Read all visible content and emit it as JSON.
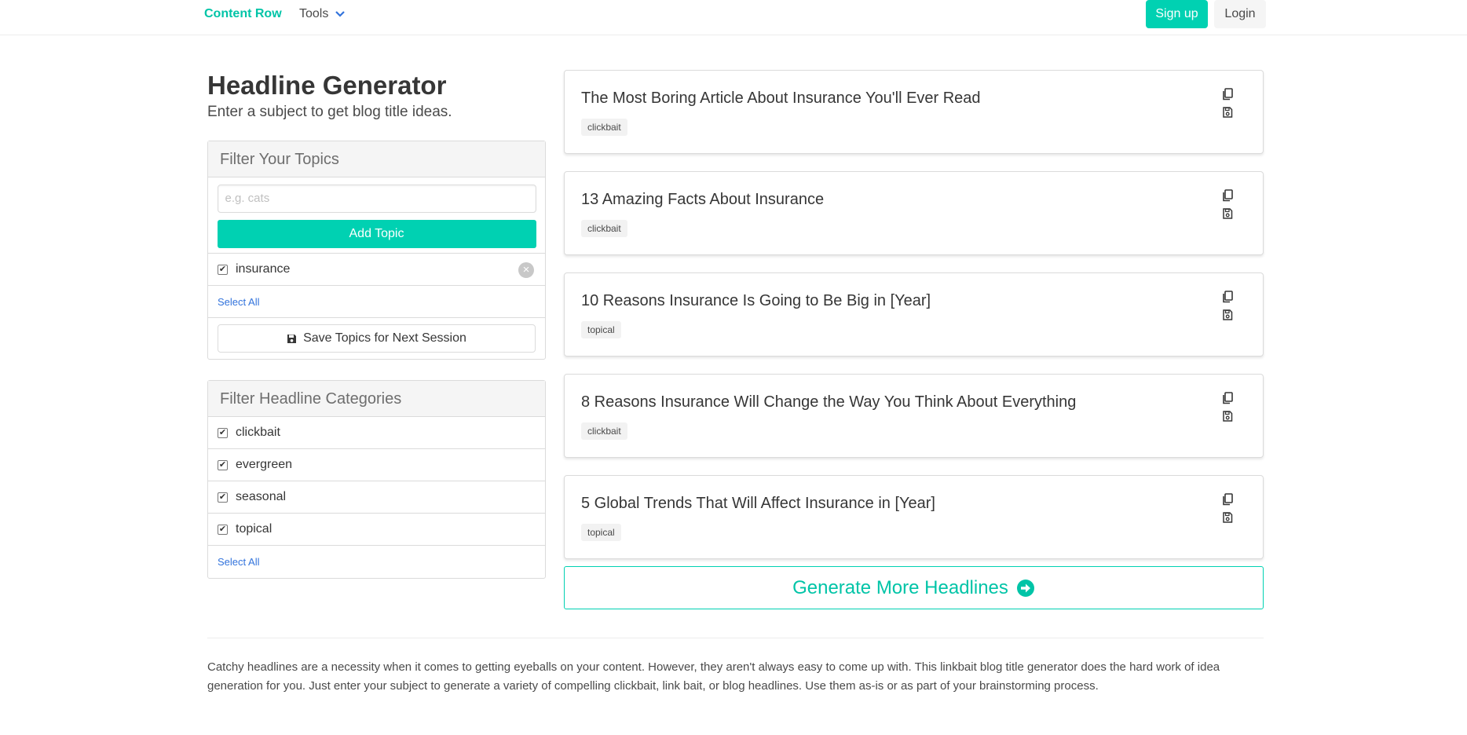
{
  "nav": {
    "brand": "Content Row",
    "tools_label": "Tools",
    "signup_label": "Sign up",
    "login_label": "Login"
  },
  "page": {
    "title": "Headline Generator",
    "subtitle": "Enter a subject to get blog title ideas."
  },
  "topics_panel": {
    "heading": "Filter Your Topics",
    "input_placeholder": "e.g. cats",
    "input_value": "",
    "add_label": "Add Topic",
    "topics": [
      {
        "label": "insurance",
        "checked": true
      }
    ],
    "select_all_label": "Select All",
    "save_label": "Save Topics for Next Session"
  },
  "categories_panel": {
    "heading": "Filter Headline Categories",
    "categories": [
      {
        "label": "clickbait",
        "checked": true
      },
      {
        "label": "evergreen",
        "checked": true
      },
      {
        "label": "seasonal",
        "checked": true
      },
      {
        "label": "topical",
        "checked": true
      }
    ],
    "select_all_label": "Select All"
  },
  "headlines": [
    {
      "title": "The Most Boring Article About Insurance You'll Ever Read",
      "tag": "clickbait"
    },
    {
      "title": "13 Amazing Facts About Insurance",
      "tag": "clickbait"
    },
    {
      "title": "10 Reasons Insurance Is Going to Be Big in [Year]",
      "tag": "topical"
    },
    {
      "title": "8 Reasons Insurance Will Change the Way You Think About Everything",
      "tag": "clickbait"
    },
    {
      "title": "5 Global Trends That Will Affect Insurance in [Year]",
      "tag": "topical"
    }
  ],
  "generate_label": "Generate More Headlines",
  "footer_text": "Catchy headlines are a necessity when it comes to getting eyeballs on your content. However, they aren't always easy to come up with. This linkbait blog title generator does the hard work of idea generation for you. Just enter your subject to generate a variety of compelling clickbait, link bait, or blog headlines. Use them as-is or as part of your brainstorming process.",
  "colors": {
    "accent": "#00d1b2",
    "link": "#3273dc"
  },
  "icons": {
    "tools_dropdown": "chevron-down-icon",
    "save_topics": "floppy-disk-icon",
    "delete_topic": "delete-circle-icon",
    "copy": "copy-icon",
    "save_headline": "save-icon",
    "generate": "arrow-circle-right-icon"
  }
}
